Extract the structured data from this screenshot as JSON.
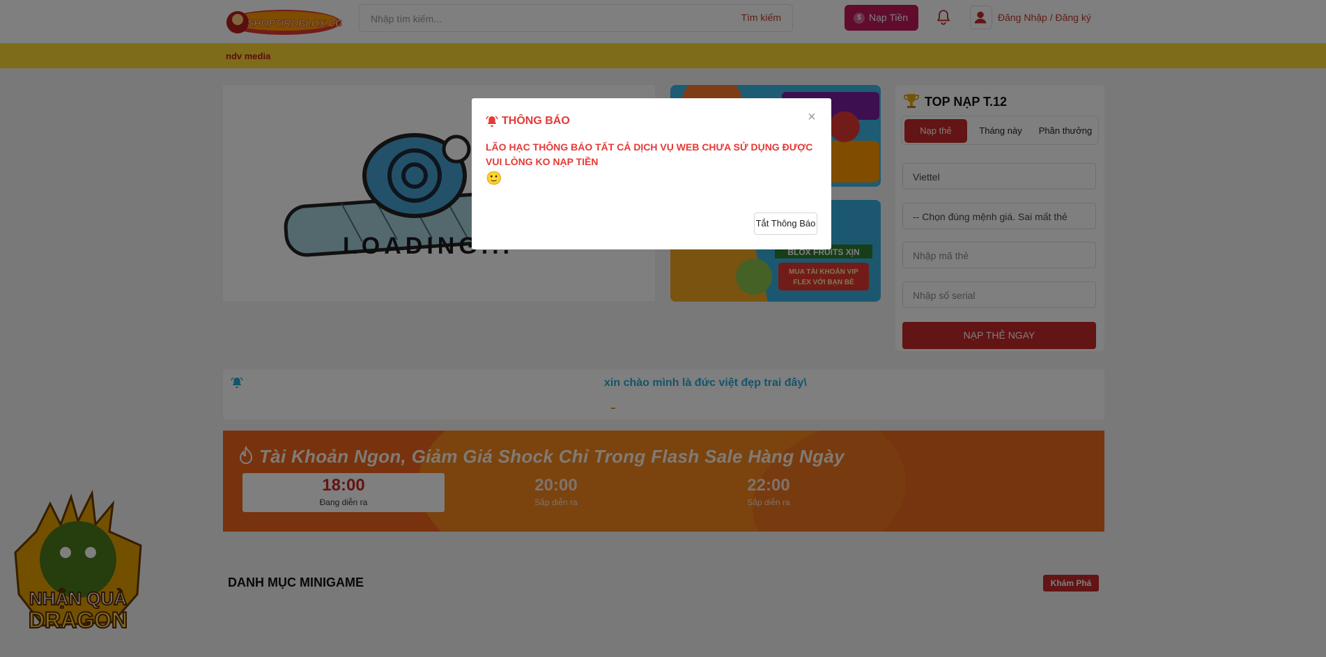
{
  "header": {
    "logo_text": "SHOPTIROBLOX.COM",
    "search_placeholder": "Nhập tìm kiếm...",
    "search_button": "Tìm kiếm",
    "topup_button": "Nạp Tiền",
    "topup_icon": "coin-icon",
    "bell_icon": "bell-icon",
    "login_label": "Đăng Nhập / Đăng ký",
    "user_icon": "user-icon"
  },
  "ticker": {
    "text": "ndv media"
  },
  "banner": {
    "loading_text": "LOADING...",
    "side_promo_2_line1": "BLOX FRUITS XỊN",
    "side_promo_2_line2": "MUA TÀI KHOẢN VIP",
    "side_promo_2_line3": "FLEX VỚI BẠN BÈ"
  },
  "top_panel": {
    "title": "TOP NẠP T.12",
    "tabs": [
      {
        "label": "Nạp thẻ",
        "active": true
      },
      {
        "label": "Tháng này",
        "active": false
      },
      {
        "label": "Phần thưởng",
        "active": false
      }
    ],
    "telco_value": "Viettel",
    "denomination_placeholder": "-- Chọn đúng mệnh giá. Sai mất thẻ",
    "code_placeholder": "Nhập mã thẻ",
    "serial_placeholder": "Nhập số serial",
    "submit_label": "NẠP THẺ NGAY"
  },
  "notice": {
    "text": "xin chào mình là đức việt đẹp trai đây\\"
  },
  "flash_sale": {
    "title": "Tài Khoản Ngon, Giảm Giá Shock Chỉ Trong Flash Sale Hàng Ngày",
    "slots": [
      {
        "time": "18:00",
        "status": "Đang diễn ra",
        "active": true
      },
      {
        "time": "20:00",
        "status": "Sắp diễn ra",
        "active": false
      },
      {
        "time": "22:00",
        "status": "Sắp diễn ra",
        "active": false
      }
    ]
  },
  "minigame": {
    "title": "DANH MỤC MINIGAME",
    "explore_button": "Khám Phá"
  },
  "dragon_badge": {
    "line1": "NHẬN QUÀ",
    "line2": "DRAGON"
  },
  "modal": {
    "title": "THÔNG BÁO",
    "message": "LÃO HẠC THÔNG BÁO TẤT CẢ DỊCH VỤ WEB CHƯA SỬ DỤNG ĐƯỢC VUI LÒNG KO NẠP TIỀN",
    "emoji": "🙂",
    "close_symbol": "×",
    "dismiss_button": "Tắt Thông Báo"
  },
  "colors": {
    "brand_red": "#c62828",
    "topup_pink": "#c2185b",
    "ticker_yellow": "#fdd835",
    "flash_orange": "#f0641c",
    "notice_blue": "#29a9d9"
  }
}
